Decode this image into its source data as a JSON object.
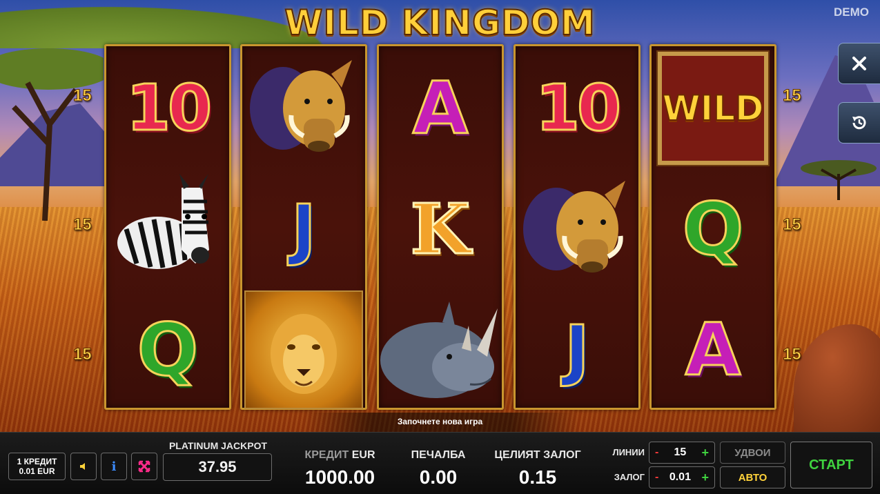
{
  "game": {
    "title": "WILD KINGDOM",
    "mode_badge": "DEMO"
  },
  "reels": [
    [
      "10",
      "zebra",
      "Q"
    ],
    [
      "warthog",
      "J",
      "lion"
    ],
    [
      "A",
      "K",
      "rhino"
    ],
    [
      "10",
      "warthog",
      "J"
    ],
    [
      "WILD",
      "Q",
      "A"
    ]
  ],
  "symbols": {
    "ten": "10",
    "ace": "A",
    "king": "K",
    "queen": "Q",
    "jack": "J",
    "wild": "WILD"
  },
  "line_numbers": {
    "left": [
      "15",
      "15",
      "15"
    ],
    "right": [
      "15",
      "15",
      "15"
    ]
  },
  "side_buttons": {
    "close": "close-icon",
    "history": "history-icon"
  },
  "status_message": "Започнете нова игра",
  "bottom_bar": {
    "denomination_line1": "1 КРЕДИТ",
    "denomination_line2": "0.01 EUR",
    "jackpot_label": "PLATINUM JACKPOT",
    "jackpot_value": "37.95",
    "credit_label": "КРЕДИТ",
    "credit_currency": "EUR",
    "credit_value": "1000.00",
    "win_label": "ПЕЧАЛБА",
    "win_value": "0.00",
    "total_bet_label": "ЦЕЛИЯТ ЗАЛОГ",
    "total_bet_value": "0.15",
    "lines_label": "ЛИНИИ",
    "lines_value": "15",
    "bet_label": "ЗАЛОГ",
    "bet_value": "0.01",
    "minus": "-",
    "plus": "+",
    "double_label": "УДВОИ",
    "auto_label": "АВТО",
    "start_label": "СТАРТ"
  },
  "colors": {
    "reel_border": "#c9962e",
    "start_green": "#3fd23f",
    "auto_yellow": "#ffd23a",
    "minus_red": "#ff3b3b"
  }
}
